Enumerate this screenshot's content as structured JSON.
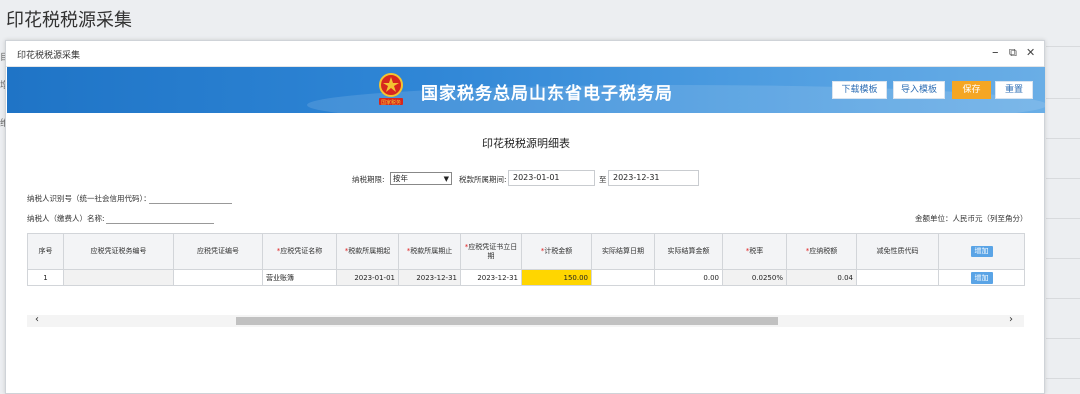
{
  "page": {
    "title": "印花税税源采集"
  },
  "dialog": {
    "title": "印花税税源采集",
    "controls": {
      "minimize": "–",
      "restore": "⧉",
      "close": "✕"
    }
  },
  "banner": {
    "title": "国家税务总局山东省电子税务局",
    "emblem_text": "国家税务",
    "buttons": {
      "download": "下载模板",
      "import": "导入模板",
      "save": "保存",
      "reset": "重置"
    },
    "colors": {
      "banner": "#2f86d6",
      "save": "#f5a623"
    }
  },
  "form": {
    "heading": "印花税税源明细表",
    "period_type_label": "纳税期限:",
    "period_type_value": "按年",
    "tax_period_label": "税款所属期间:",
    "period_start": "2023-01-01",
    "period_to": "至",
    "period_end": "2023-12-31",
    "taxpayer_id_label": "纳税人识别号（统一社会信用代码）：",
    "taxpayer_name_label": "纳税人（缴费人）名称:",
    "amount_unit": "金额单位：人民币元（列至角分）"
  },
  "table": {
    "headers": [
      {
        "text": "序号",
        "required": false
      },
      {
        "text": "应税凭证税务编号",
        "required": false
      },
      {
        "text": "应税凭证编号",
        "required": false
      },
      {
        "text": "应税凭证名称",
        "required": true
      },
      {
        "text": "税款所属期起",
        "required": true
      },
      {
        "text": "税款所属期止",
        "required": true
      },
      {
        "text": "应税凭证书立日期",
        "required": true
      },
      {
        "text": "计税金额",
        "required": true
      },
      {
        "text": "实际结算日期",
        "required": false
      },
      {
        "text": "实际结算金额",
        "required": false
      },
      {
        "text": "税率",
        "required": true
      },
      {
        "text": "应纳税额",
        "required": true
      },
      {
        "text": "减免性质代码",
        "required": false
      },
      {
        "text": "增加",
        "required": false
      }
    ],
    "rows": [
      {
        "seq": "1",
        "voucher_tax_no": "",
        "voucher_no": "",
        "voucher_name": "营业账簿",
        "period_start": "2023-01-01",
        "period_end": "2023-12-31",
        "sign_date": "2023-12-31",
        "taxable_amount": "150.00",
        "settle_date": "",
        "settle_amount": "0.00",
        "rate": "0.0250%",
        "tax_payable": "0.04",
        "exemption_code": "",
        "action": "增加"
      }
    ]
  },
  "scrollbar": {
    "left": "‹",
    "right": "›"
  },
  "background": {
    "left_chars": [
      "目",
      "增",
      "维"
    ]
  }
}
